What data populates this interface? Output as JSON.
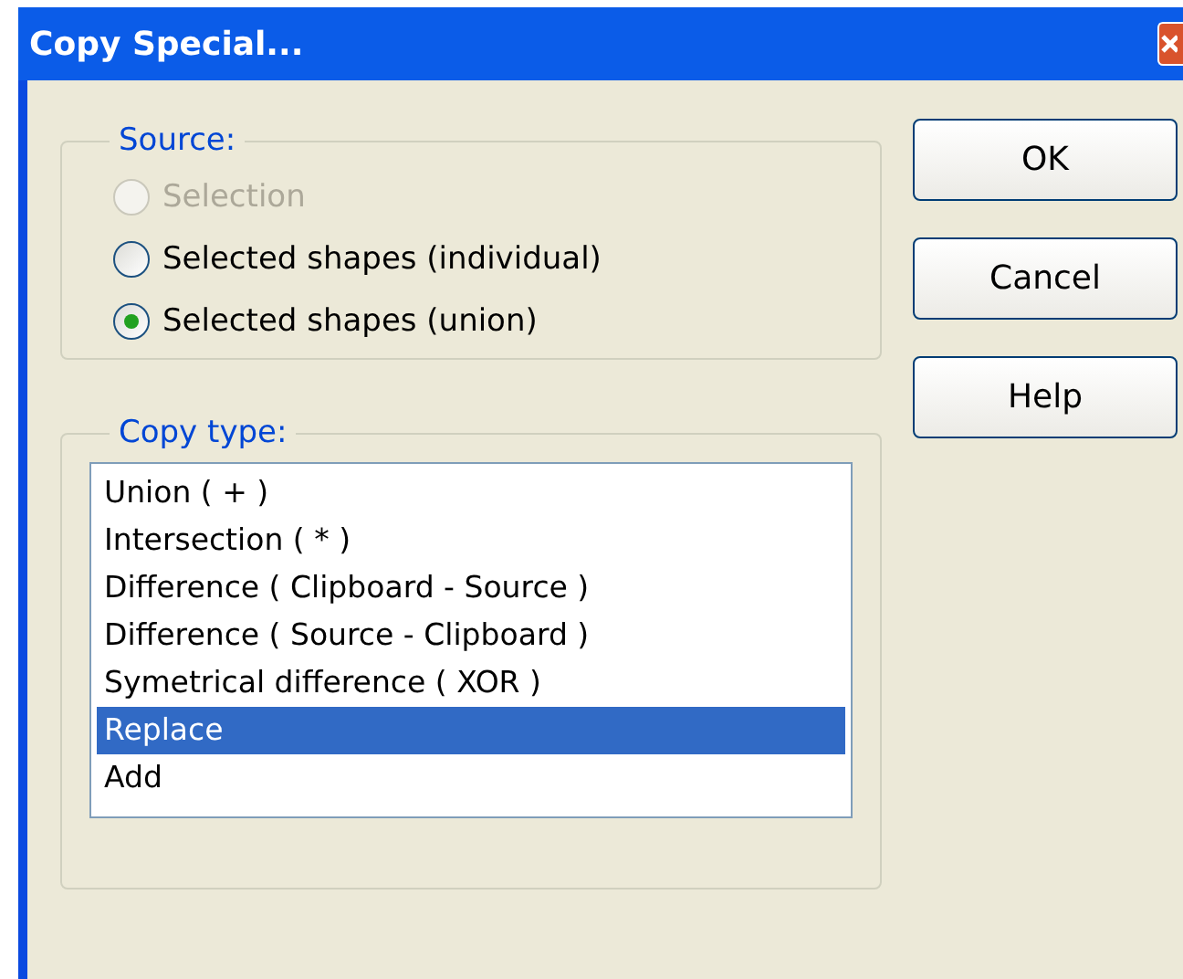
{
  "window": {
    "title": "Copy Special..."
  },
  "source": {
    "label": "Source:",
    "options": [
      {
        "label": "Selection",
        "selected": false,
        "disabled": true
      },
      {
        "label": "Selected shapes (individual)",
        "selected": false,
        "disabled": false
      },
      {
        "label": "Selected shapes (union)",
        "selected": true,
        "disabled": false
      }
    ]
  },
  "copy_type": {
    "label": "Copy type:",
    "items": [
      {
        "label": "Union ( + )",
        "selected": false
      },
      {
        "label": "Intersection ( * )",
        "selected": false
      },
      {
        "label": "Difference ( Clipboard - Source )",
        "selected": false
      },
      {
        "label": "Difference ( Source - Clipboard )",
        "selected": false
      },
      {
        "label": "Symetrical difference ( XOR )",
        "selected": false
      },
      {
        "label": "Replace",
        "selected": true
      },
      {
        "label": "Add",
        "selected": false
      }
    ]
  },
  "buttons": [
    "OK",
    "Cancel",
    "Help"
  ]
}
